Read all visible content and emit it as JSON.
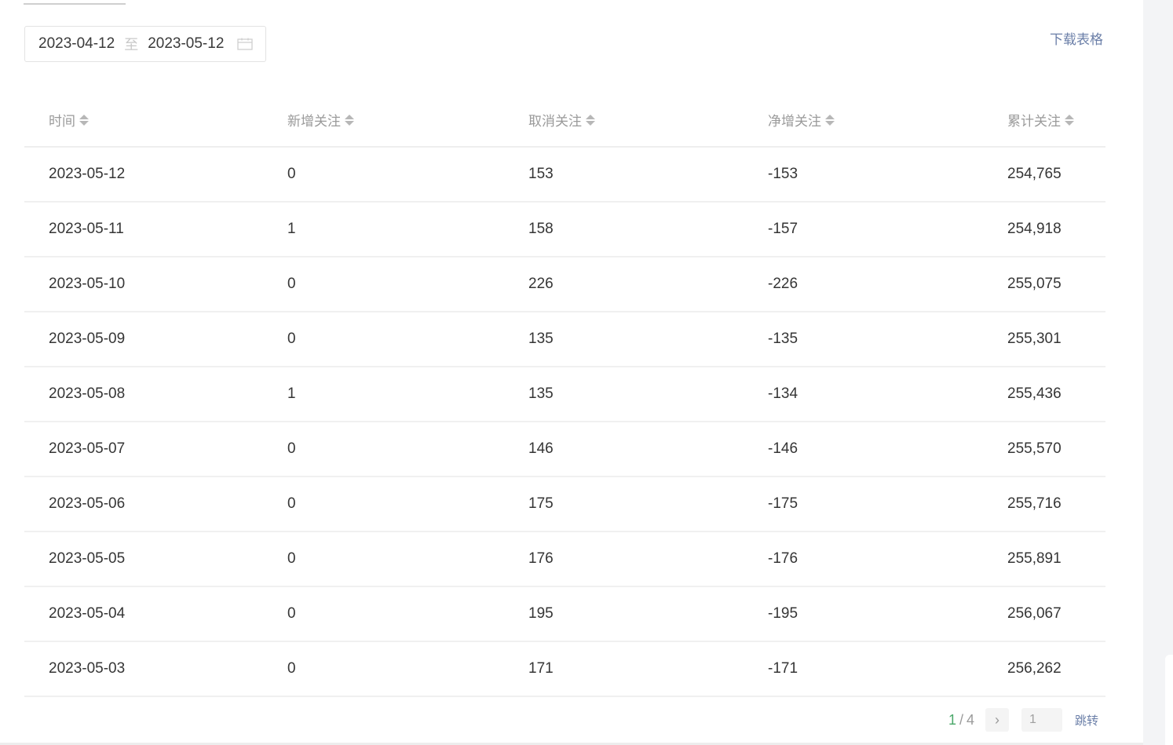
{
  "date_range": {
    "start": "2023-04-12",
    "separator": "至",
    "end": "2023-05-12",
    "icon": "calendar-icon"
  },
  "download_label": "下载表格",
  "table": {
    "columns": [
      "时间",
      "新增关注",
      "取消关注",
      "净增关注",
      "累计关注"
    ],
    "rows": [
      [
        "2023-05-12",
        "0",
        "153",
        "-153",
        "254,765"
      ],
      [
        "2023-05-11",
        "1",
        "158",
        "-157",
        "254,918"
      ],
      [
        "2023-05-10",
        "0",
        "226",
        "-226",
        "255,075"
      ],
      [
        "2023-05-09",
        "0",
        "135",
        "-135",
        "255,301"
      ],
      [
        "2023-05-08",
        "1",
        "135",
        "-134",
        "255,436"
      ],
      [
        "2023-05-07",
        "0",
        "146",
        "-146",
        "255,570"
      ],
      [
        "2023-05-06",
        "0",
        "175",
        "-175",
        "255,716"
      ],
      [
        "2023-05-05",
        "0",
        "176",
        "-176",
        "255,891"
      ],
      [
        "2023-05-04",
        "0",
        "195",
        "-195",
        "256,067"
      ],
      [
        "2023-05-03",
        "0",
        "171",
        "-171",
        "256,262"
      ]
    ]
  },
  "pagination": {
    "current": "1",
    "separator": "/",
    "total": "4",
    "next_symbol": "›",
    "input_value": "1",
    "jump_label": "跳转"
  },
  "colors": {
    "link": "#6b7fa8",
    "current_page": "#4aa86a",
    "header_text": "#9a9a9a",
    "cell_text": "#353535"
  }
}
